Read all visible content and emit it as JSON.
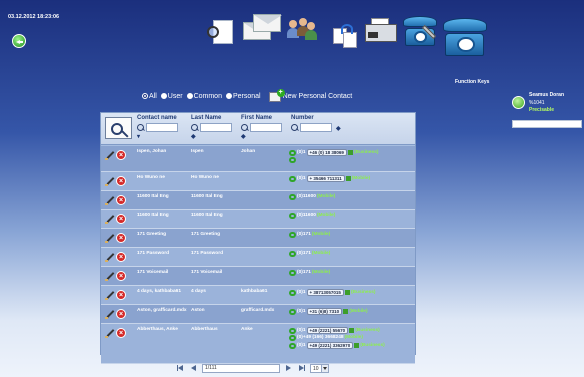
{
  "header": {
    "datetime": "03.12.2012 18:23:06"
  },
  "toolbar": {
    "items": [
      "contacts-search",
      "messages",
      "people",
      "sync",
      "fax",
      "phone-settings",
      "function-keys"
    ],
    "function_keys_label": "Function Keys"
  },
  "user": {
    "name": "Seamus Doran",
    "extension": "%1041",
    "status": "Precisable"
  },
  "filters": {
    "options": [
      {
        "label": "All",
        "selected": true
      },
      {
        "label": "User",
        "selected": false
      },
      {
        "label": "Common",
        "selected": false
      },
      {
        "label": "Personal",
        "selected": false
      }
    ],
    "new_contact_label": "New Personal Contact"
  },
  "table": {
    "columns": [
      "Contact name",
      "Last Name",
      "First Name",
      "Number"
    ],
    "rows": [
      {
        "contact": "Ispen, Johan",
        "last": "Ispen",
        "first": "Johan",
        "numbers": [
          {
            "num": "(0)1",
            "chip": "+46 (0) 18 38069",
            "type": "(Business)"
          },
          {
            "num": "",
            "chip": "",
            "type": ""
          }
        ]
      },
      {
        "contact": "Ho Wuno ne",
        "last": "Ho Wuno ne",
        "first": "",
        "numbers": [
          {
            "num": "(0)1",
            "chip": "+ 35466 711311",
            "type": "(Mobile)"
          }
        ]
      },
      {
        "contact": "11600 Ital Eng",
        "last": "11600 Ital Eng",
        "first": "",
        "numbers": [
          {
            "num": "(0)11600",
            "chip": "",
            "type": "(Mobile)"
          }
        ]
      },
      {
        "contact": "11600 Ital Eng",
        "last": "11600 Ital Eng",
        "first": "",
        "numbers": [
          {
            "num": "(0)11600",
            "chip": "",
            "type": "(Mobile)"
          }
        ]
      },
      {
        "contact": "171 Greeting",
        "last": "171 Greeting",
        "first": "",
        "numbers": [
          {
            "num": "(0)171",
            "chip": "",
            "type": "(Mobile)"
          }
        ]
      },
      {
        "contact": "171 Password",
        "last": "171 Password",
        "first": "",
        "numbers": [
          {
            "num": "(0)171",
            "chip": "",
            "type": "(Mobile)"
          }
        ]
      },
      {
        "contact": "171 Voicemail",
        "last": "171 Voicemail",
        "first": "",
        "numbers": [
          {
            "num": "(0)171",
            "chip": "",
            "type": "(Mobile)"
          }
        ]
      },
      {
        "contact": "4 days, kathbaba61",
        "last": "4 days",
        "first": "kathbaba61",
        "numbers": [
          {
            "num": "(0)1",
            "chip": "+ 38713057015",
            "type": "(Business)"
          }
        ]
      },
      {
        "contact": "Aston, grafficard.mdx",
        "last": "Aston",
        "first": "grafficard.mdx",
        "numbers": [
          {
            "num": "(0)1",
            "chip": "+31 (6)8) 7310",
            "type": "(Mobile)"
          }
        ]
      },
      {
        "contact": "Abberthaus, Anke",
        "last": "Abberthaus",
        "first": "Anke",
        "numbers": [
          {
            "num": "(0)1",
            "chip": "+49 (2221) 55670",
            "type": "(Business)"
          },
          {
            "num": "(0)+49 (166) 3668248",
            "chip": "",
            "type": "(Mobile)"
          },
          {
            "num": "(0)1",
            "chip": "+49 (2221) 3362970",
            "type": "(Business)"
          }
        ]
      }
    ]
  },
  "pager": {
    "page_value": "1/111",
    "per_page": "10"
  }
}
